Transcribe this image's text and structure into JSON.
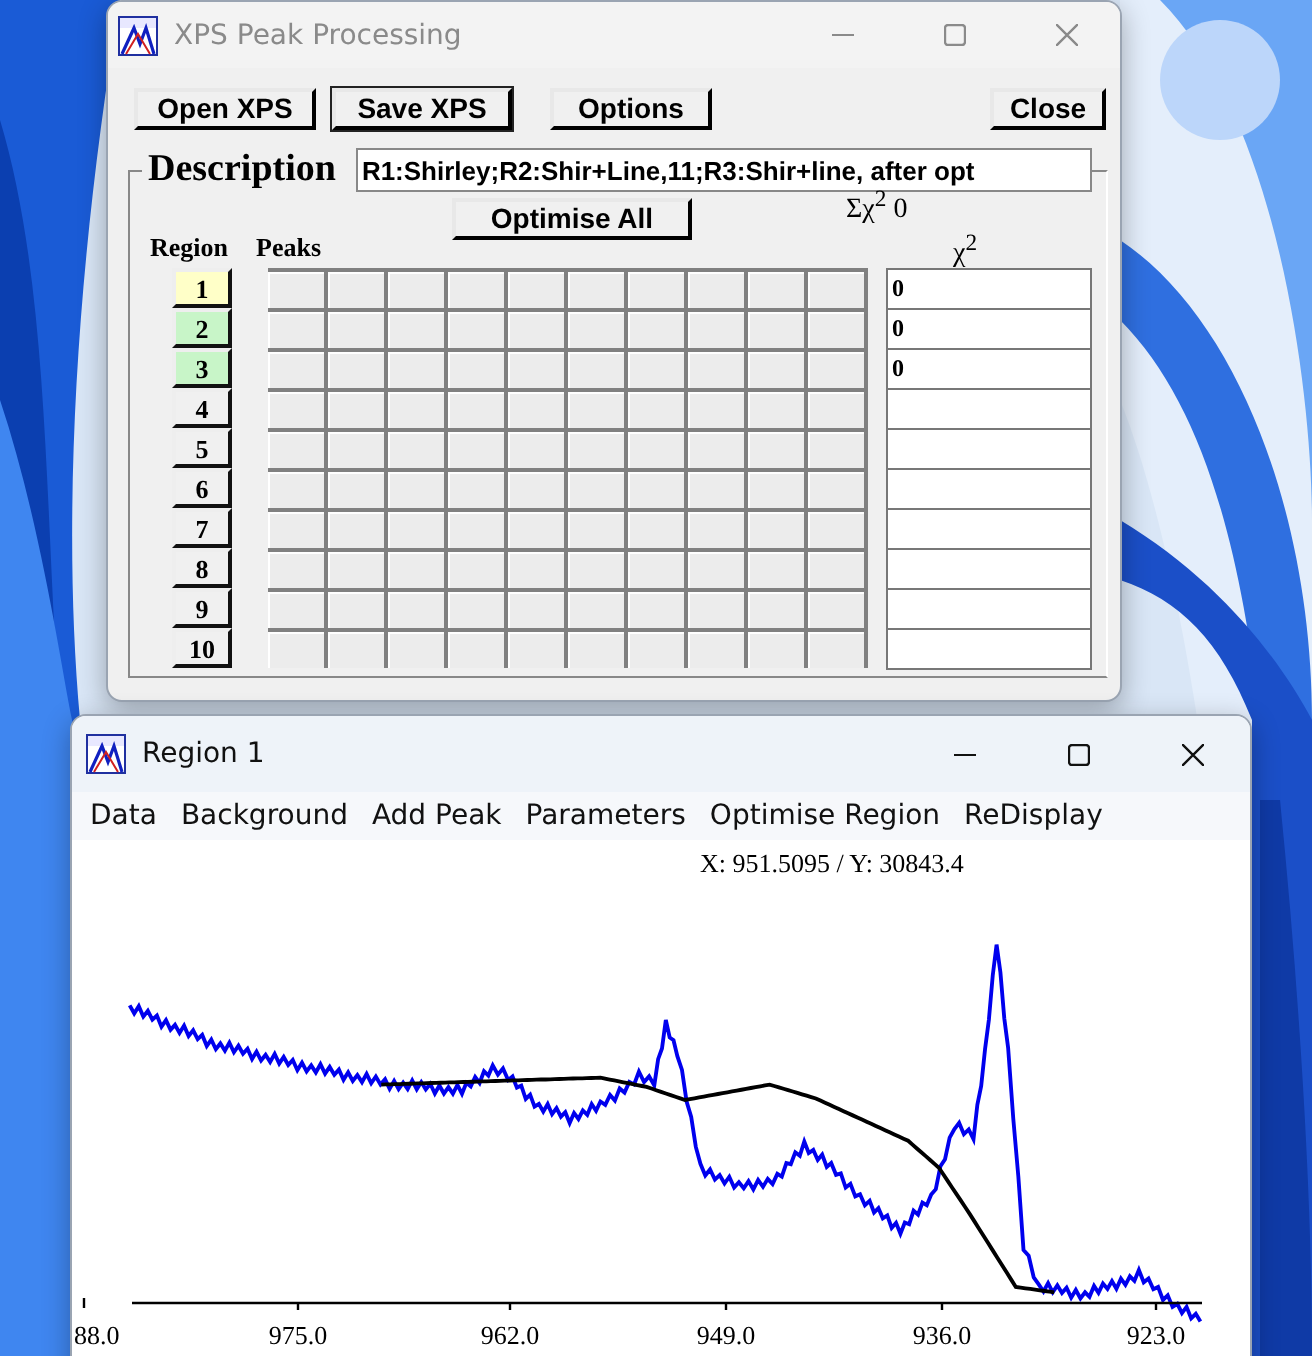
{
  "main_window": {
    "title": "XPS Peak Processing",
    "active": false,
    "buttons": [
      {
        "label": "Open XPS",
        "default": false
      },
      {
        "label": "Save XPS",
        "default": true
      },
      {
        "label": "Options",
        "default": false
      },
      {
        "label": "Close",
        "default": false
      }
    ],
    "description": {
      "label": "Description",
      "value": "R1:Shirley;R2:Shir+Line,11;R3:Shir+line, after opt"
    },
    "optimise_button": "Optimise All",
    "chi_sum": "Σχ$^{2}$ 0",
    "region_header": "Region",
    "peaks_header": "Peaks",
    "chi_header": "χ$^{2}$",
    "regions": [
      {
        "label": "1",
        "color": "#ffffc8",
        "chi2": "0"
      },
      {
        "label": "2",
        "color": "#c8f5c8",
        "chi2": "0"
      },
      {
        "label": "3",
        "color": "#c8f5c8",
        "chi2": "0"
      },
      {
        "label": "4",
        "color": "#f0f0f0"
      },
      {
        "label": "5",
        "color": "#f0f0f0"
      },
      {
        "label": "6",
        "color": "#f0f0f0"
      },
      {
        "label": "7",
        "color": "#f0f0f0"
      },
      {
        "label": "8",
        "color": "#f0f0f0"
      },
      {
        "label": "9",
        "color": "#f0f0f0"
      },
      {
        "label": "10",
        "color": "#f0f0f0"
      }
    ]
  },
  "region_window": {
    "title": "Region 1",
    "active": true,
    "menu": [
      "Data",
      "Background",
      "Add Peak",
      "Parameters",
      "Optimise Region",
      "ReDisplay"
    ],
    "cursor_readout": "X: 951.5095 / Y: 30843.4",
    "x_tick_labels": [
      "88.0",
      "975.0",
      "962.0",
      "949.0",
      "936.0",
      "923.0"
    ]
  }
}
